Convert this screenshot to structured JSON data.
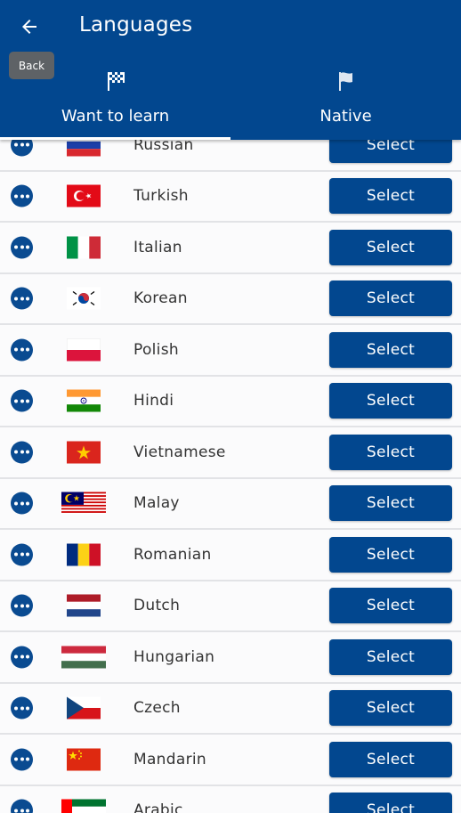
{
  "header": {
    "title": "Languages",
    "back_tooltip": "Back",
    "tabs": [
      {
        "label": "Want to learn",
        "icon": "checkered-flag-icon",
        "active": true
      },
      {
        "label": "Native",
        "icon": "flag-icon",
        "active": false
      }
    ]
  },
  "colors": {
    "primary": "#02478f",
    "row_bg": "#fbfbfc",
    "divider": "#e2e3e6"
  },
  "languages": [
    {
      "name": "Russian",
      "flag": "russia-flag-icon",
      "button": "Select"
    },
    {
      "name": "Turkish",
      "flag": "turkey-flag-icon",
      "button": "Select"
    },
    {
      "name": "Italian",
      "flag": "italy-flag-icon",
      "button": "Select"
    },
    {
      "name": "Korean",
      "flag": "south-korea-flag-icon",
      "button": "Select"
    },
    {
      "name": "Polish",
      "flag": "poland-flag-icon",
      "button": "Select"
    },
    {
      "name": "Hindi",
      "flag": "india-flag-icon",
      "button": "Select"
    },
    {
      "name": "Vietnamese",
      "flag": "vietnam-flag-icon",
      "button": "Select"
    },
    {
      "name": "Malay",
      "flag": "malaysia-flag-icon",
      "button": "Select"
    },
    {
      "name": "Romanian",
      "flag": "romania-flag-icon",
      "button": "Select"
    },
    {
      "name": "Dutch",
      "flag": "netherlands-flag-icon",
      "button": "Select"
    },
    {
      "name": "Hungarian",
      "flag": "hungary-flag-icon",
      "button": "Select"
    },
    {
      "name": "Czech",
      "flag": "czech-flag-icon",
      "button": "Select"
    },
    {
      "name": "Mandarin",
      "flag": "china-flag-icon",
      "button": "Select"
    },
    {
      "name": "Arabic",
      "flag": "uae-flag-icon",
      "button": "Select"
    }
  ]
}
